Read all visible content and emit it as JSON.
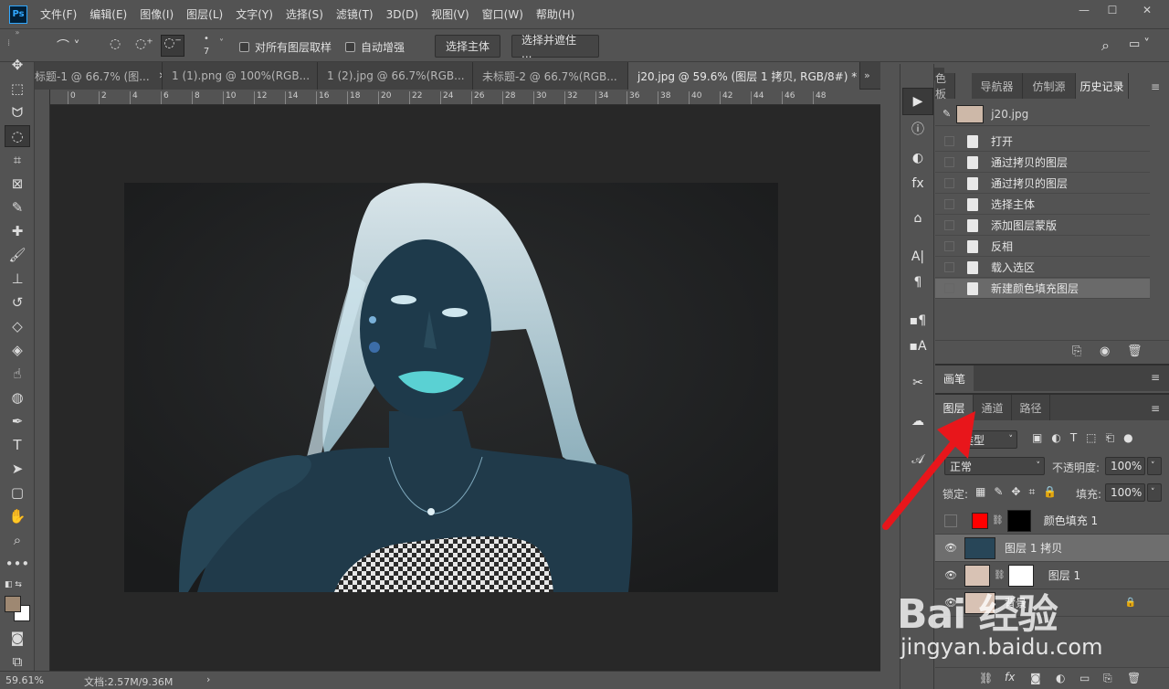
{
  "app": {
    "logo_text": "Ps",
    "menu": [
      "文件(F)",
      "编辑(E)",
      "图像(I)",
      "图层(L)",
      "文字(Y)",
      "选择(S)",
      "滤镜(T)",
      "3D(D)",
      "视图(V)",
      "窗口(W)",
      "帮助(H)"
    ]
  },
  "options": {
    "brush_size": "7",
    "sample_all_layers": "对所有图层取样",
    "auto_enhance": "自动增强",
    "select_subject": "选择主体",
    "select_and_mask": "选择并遮住 ..."
  },
  "tabs": [
    {
      "label": "标题-1 @ 66.7% (图..."
    },
    {
      "label": "1 (1).png @ 100%(RGB..."
    },
    {
      "label": "1 (2).jpg @ 66.7%(RGB..."
    },
    {
      "label": "未标题-2 @ 66.7%(RGB..."
    },
    {
      "label": "j20.jpg @ 59.6% (图层 1 拷贝, RGB/8#) *"
    }
  ],
  "ruler_ticks": [
    "20",
    "0",
    "2",
    "4",
    "6",
    "8",
    "10",
    "12",
    "14",
    "16",
    "18",
    "20",
    "22",
    "24",
    "26",
    "28",
    "30",
    "32",
    "34",
    "36",
    "38",
    "40",
    "42",
    "44",
    "46",
    "48"
  ],
  "status": {
    "zoom": "59.61%",
    "doc": "文档:2.57M/9.36M",
    "arrow": "›"
  },
  "history_panel": {
    "tabs": [
      "色板",
      "导航器",
      "仿制源",
      "历史记录"
    ],
    "active_tab": "历史记录",
    "snapshot": "j20.jpg",
    "items": [
      "打开",
      "通过拷贝的图层",
      "通过拷贝的图层",
      "选择主体",
      "添加图层蒙版",
      "反相",
      "载入选区",
      "新建颜色填充图层"
    ]
  },
  "brush_panel": {
    "title": "画笔"
  },
  "layers_panel": {
    "tabs": [
      "图层",
      "通道",
      "路径"
    ],
    "kind_label": "类型",
    "blend_mode": "正常",
    "opacity_label": "不透明度:",
    "opacity_value": "100%",
    "lock_label": "锁定:",
    "fill_label": "填充:",
    "fill_value": "100%",
    "layers": [
      {
        "name": "颜色填充 1",
        "visible": false,
        "color": "#ff0000"
      },
      {
        "name": "图层 1 拷贝",
        "visible": true,
        "selected": true
      },
      {
        "name": "图层 1",
        "visible": true
      },
      {
        "name": "背景",
        "visible": true,
        "locked": true
      }
    ]
  },
  "watermark": {
    "logo": "Bai 经验",
    "url": "jingyan.baidu.com"
  },
  "colors": {
    "foreground": "#9e8872",
    "background": "#ffffff",
    "arrow": "#e8161b"
  }
}
